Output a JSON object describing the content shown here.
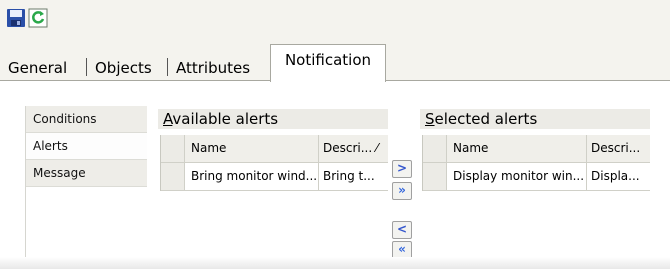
{
  "toolbar": {
    "save_icon": "save-disk-icon",
    "refresh_icon": "refresh-icon",
    "colors": {
      "disk": "#2a4fa8",
      "refresh": "#2aa84a"
    }
  },
  "tabs": {
    "general": "General",
    "objects": "Objects",
    "attributes": "Attributes",
    "notification": "Notification",
    "active": "Notification"
  },
  "menu": {
    "items": [
      {
        "label": "Conditions",
        "selected": false
      },
      {
        "label": "Alerts",
        "selected": true
      },
      {
        "label": "Message",
        "selected": false
      }
    ]
  },
  "available": {
    "title_letter": "A",
    "title_rest": "vailable alerts",
    "columns": {
      "name": "Name",
      "description": "Descri... ⁄"
    },
    "rows": [
      {
        "name": "Bring monitor wind...",
        "description": "Bring t..."
      }
    ]
  },
  "selected": {
    "title_letter": "S",
    "title_rest": "elected alerts",
    "columns": {
      "name": "Name",
      "description": "Descri..."
    },
    "rows": [
      {
        "name": "Display monitor win...",
        "description": "Displa..."
      }
    ]
  },
  "move_buttons": {
    "add": ">",
    "add_all": "»",
    "remove": "<",
    "remove_all": "«"
  }
}
